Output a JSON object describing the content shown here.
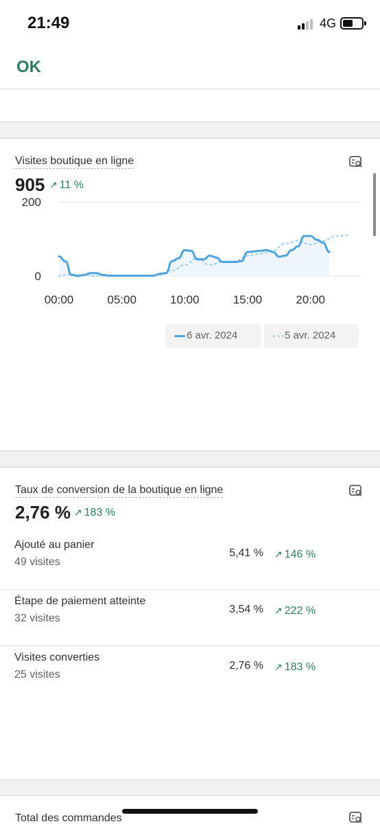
{
  "status": {
    "time": "21:49",
    "network": "4G"
  },
  "nav": {
    "ok_label": "OK"
  },
  "visits_card": {
    "title": "Visites boutique en ligne",
    "value": "905",
    "trend": "11 %",
    "legend": [
      "6 avr. 2024",
      "5 avr. 2024"
    ],
    "explore_icon": "chart-explore-icon"
  },
  "chart_data": {
    "type": "line",
    "title": "Visites boutique en ligne",
    "xlabel": "",
    "ylabel": "",
    "x_ticks": [
      "00:00",
      "05:00",
      "10:00",
      "15:00",
      "20:00"
    ],
    "y_ticks": [
      "0",
      "200"
    ],
    "xlim": [
      0,
      24
    ],
    "ylim": [
      0,
      200
    ],
    "grid": true,
    "legend_position": "bottom-right",
    "series": [
      {
        "name": "6 avr. 2024",
        "style": "solid",
        "color": "#4ea3dc",
        "x": [
          0,
          0.5,
          1,
          1.5,
          2,
          2.5,
          3,
          3.5,
          4,
          5,
          6,
          7,
          7.5,
          8,
          8.5,
          9,
          9.5,
          10,
          10.5,
          11,
          11.5,
          12,
          12.5,
          13,
          14,
          14.5,
          15,
          16,
          16.5,
          17,
          17.5,
          18,
          18.5,
          19,
          19.5,
          20,
          20.5,
          21,
          21.5
        ],
        "y": [
          53,
          40,
          3,
          0,
          3,
          8,
          8,
          3,
          1,
          1,
          1,
          1,
          1,
          6,
          8,
          40,
          48,
          70,
          68,
          45,
          45,
          55,
          50,
          38,
          38,
          40,
          65,
          68,
          70,
          65,
          52,
          55,
          70,
          80,
          108,
          108,
          98,
          90,
          65
        ]
      },
      {
        "name": "5 avr. 2024",
        "style": "dotted",
        "color": "#a9d3f0",
        "x": [
          0,
          1,
          2,
          3,
          4,
          5,
          6,
          7,
          8,
          9,
          10,
          11,
          12,
          13,
          14,
          15,
          16,
          17,
          18,
          19,
          20,
          21,
          22,
          23
        ],
        "y": [
          0,
          5,
          2,
          0,
          1,
          1,
          1,
          1,
          3,
          15,
          30,
          48,
          30,
          38,
          40,
          55,
          60,
          68,
          88,
          95,
          85,
          95,
          108,
          110
        ]
      }
    ]
  },
  "conversion_card": {
    "title": "Taux de conversion de la boutique en ligne",
    "value": "2,76 %",
    "trend": "183 %",
    "rows": [
      {
        "label": "Ajouté au panier",
        "sub": "49 visites",
        "pct": "5,41 %",
        "trend": "146 %"
      },
      {
        "label": "Étape de paiement atteinte",
        "sub": "32 visites",
        "pct": "3,54 %",
        "trend": "222 %"
      },
      {
        "label": "Visites converties",
        "sub": "25 visites",
        "pct": "2,76 %",
        "trend": "183 %"
      }
    ]
  },
  "orders_card": {
    "title": "Total des commandes"
  },
  "colors": {
    "accent_green": "#2e7d5b",
    "line_primary": "#4ea3dc",
    "line_compare": "#a9d3f0"
  }
}
